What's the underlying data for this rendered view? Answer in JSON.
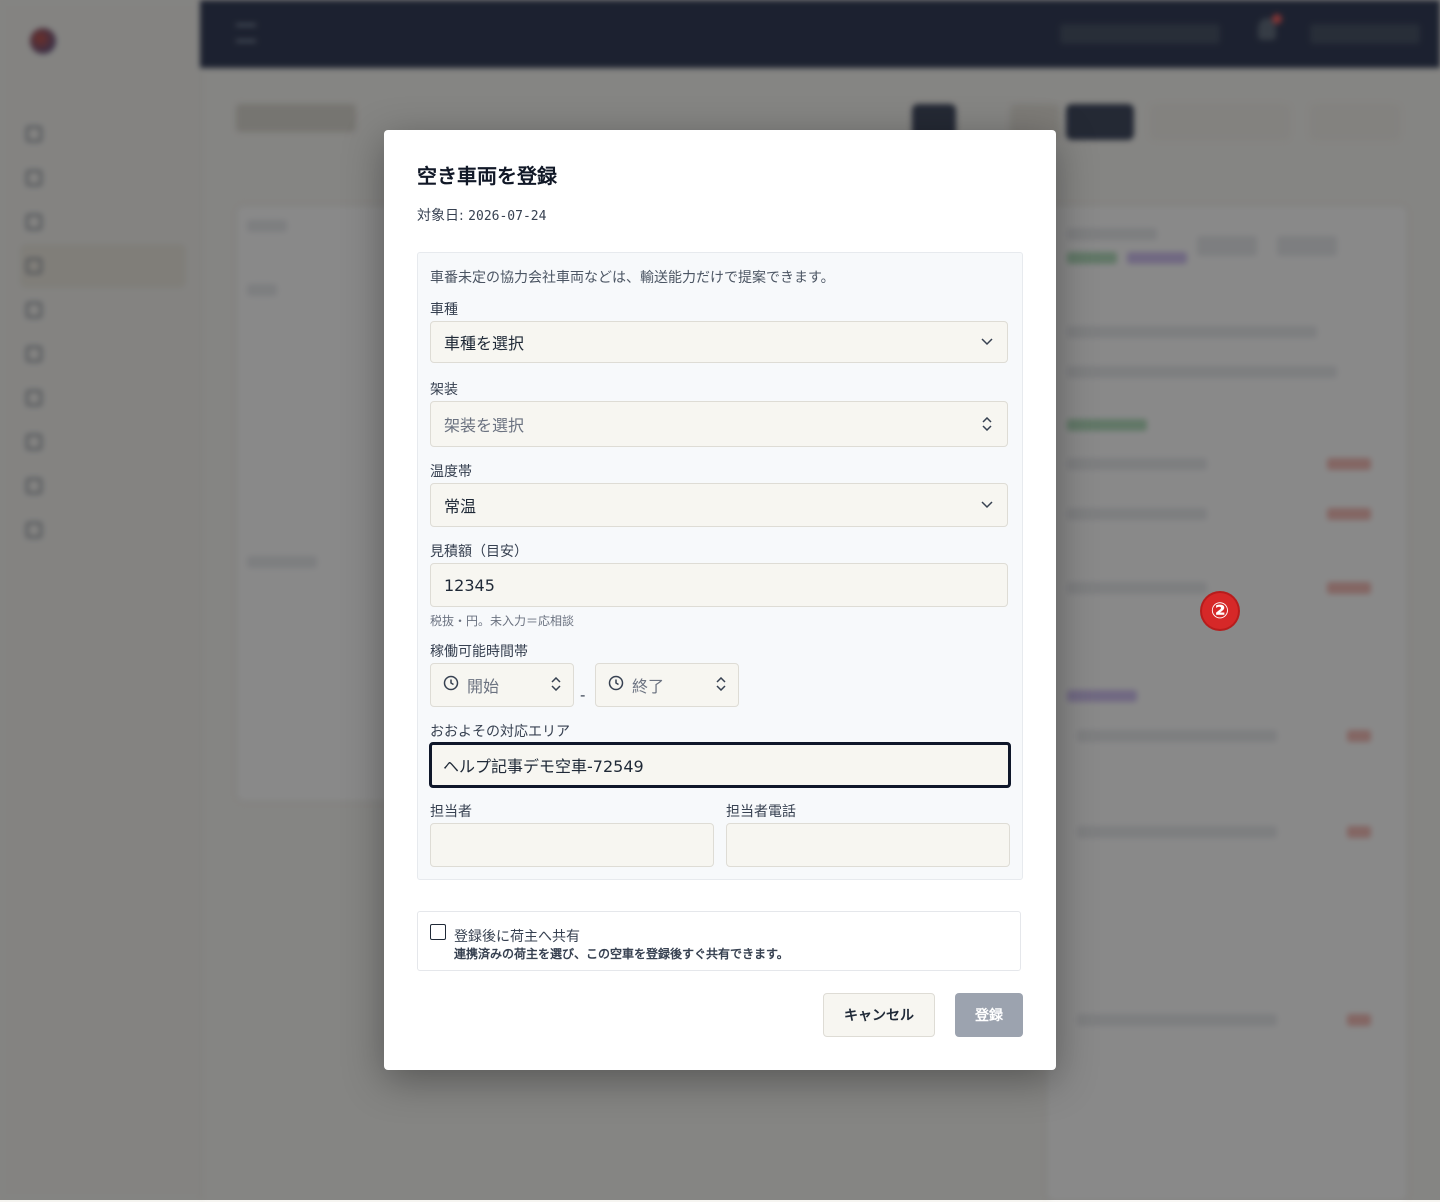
{
  "modal": {
    "title": "空き車両を登録",
    "date_label": "対象日:",
    "date_value": "2026-07-24",
    "hint": "車番未定の協力会社車両などは、輸送能力だけで提案できます。",
    "vehicle_type": {
      "label": "車種",
      "value": "車種を選択"
    },
    "body_type": {
      "label": "架装",
      "placeholder": "架装を選択"
    },
    "temperature": {
      "label": "温度帯",
      "value": "常温"
    },
    "estimate": {
      "label": "見積額（目安）",
      "value": "12345",
      "note": "税抜・円。未入力＝応相談"
    },
    "hours": {
      "label": "稼働可能時間帯",
      "start_placeholder": "開始",
      "separator": "-",
      "end_placeholder": "終了"
    },
    "area": {
      "label": "おおよその対応エリア",
      "value": "ヘルプ記事デモ空車-72549"
    },
    "contact": {
      "label": "担当者",
      "value": ""
    },
    "contact_phone": {
      "label": "担当者電話",
      "value": ""
    },
    "share": {
      "checked": false,
      "label": "登録後に荷主へ共有",
      "description": "連携済みの荷主を選び、この空車を登録後すぐ共有できます。"
    },
    "cancel_label": "キャンセル",
    "submit_label": "登録"
  },
  "annotation_badge": "②"
}
